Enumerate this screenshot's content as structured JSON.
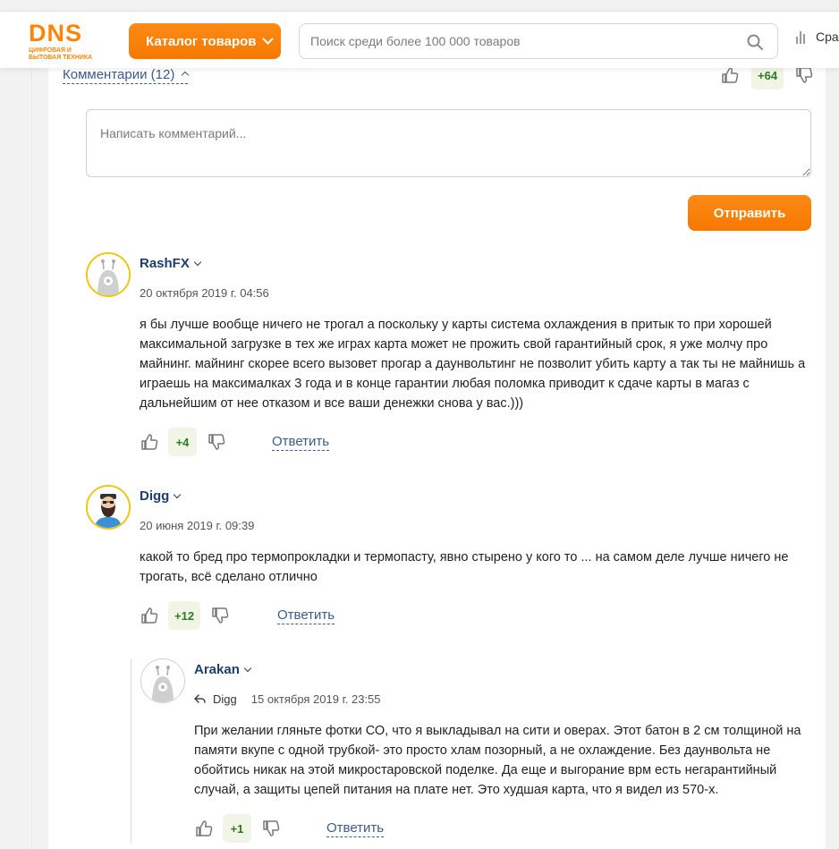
{
  "header": {
    "logo_text": "DNS",
    "logo_subtitle_line1": "ЦИФРОВАЯ И",
    "logo_subtitle_line2": "БЫТОВАЯ ТЕХНИКА",
    "catalog_label": "Каталог товаров",
    "search_placeholder": "Поиск среди более 100 000 товаров",
    "compare_label": "Сравнить"
  },
  "comments": {
    "toggle_label": "Комментарии (12)",
    "article_score": "+64",
    "input_placeholder": "Написать комментарий...",
    "send_label": "Отправить",
    "reply_label": "Ответить",
    "items": [
      {
        "author": "RashFX",
        "date": "20 октября 2019 г. 04:56",
        "text": "я бы лучше вообще ничего не трогал а поскольку у карты система охлаждения в притык то при хорошей максимальной загрузке в тех же играх карта может не прожить свой гарантийный срок, я уже молчу про майнинг. майнинг скорее всего вызовет прогар а даунвольтинг не позволит убить карту а так ты не майнишь а играешь на максималках 3 года и в конце гарантии любая поломка приводит к сдаче карты в магаз с дальнейшим от нее отказом и все ваши денежки снова у вас.)))",
        "score": "+4"
      },
      {
        "author": "Digg",
        "date": "20 июня 2019 г. 09:39",
        "text": "какой то бред про термопрокладки и термопасту, явно стырено у кого то ... на самом деле лучше ничего не трогать, всё сделано отлично",
        "score": "+12"
      },
      {
        "author": "Arakan",
        "reply_to": "Digg",
        "date": "15 октября 2019 г. 23:55",
        "text": "При желании гляньте фотки СО, что я выкладывал на сити и оверах. Этот батон в 2 см толщиной на памяти вкупе с одной трубкой- это просто хлам позорный, а не охлаждение. Без даунвольта не обойтись никак на этой микростаровской поделке. Да еще и выгорание врм есть негарантийный случай, а защиты цепей питания на плате нет. Это худшая карта, что я видел из 570-х.",
        "score": "+1"
      }
    ]
  },
  "colors": {
    "brand_orange": "#fc8507",
    "link_blue": "#3b5b8a",
    "score_green": "#2d7b1f"
  },
  "icons": [
    "search-icon",
    "compare-icon",
    "chevron-down-icon",
    "chevron-up-icon",
    "thumb-up-icon",
    "thumb-down-icon",
    "reply-arrow-icon",
    "robot-avatar",
    "bearded-man-avatar"
  ]
}
